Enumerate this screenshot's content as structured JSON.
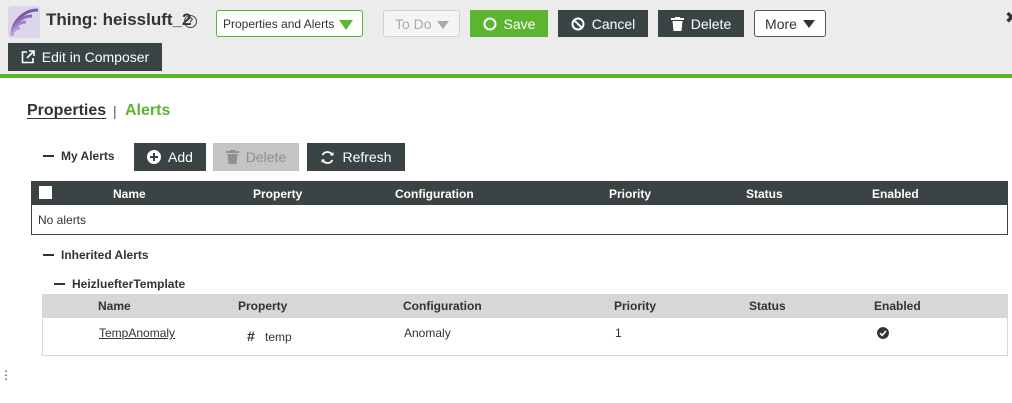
{
  "header": {
    "title": "Thing: heissluft_2",
    "help_glyph": "?",
    "view_select": "Properties and Alerts",
    "todo_select": "To Do",
    "save_label": "Save",
    "cancel_label": "Cancel",
    "delete_label": "Delete",
    "more_label": "More",
    "composer_label": "Edit in Composer",
    "close_glyph": "✖"
  },
  "tabs": {
    "properties": "Properties",
    "separator": "|",
    "alerts": "Alerts"
  },
  "my_alerts": {
    "section_label": "My Alerts",
    "add_label": "Add",
    "delete_label": "Delete",
    "refresh_label": "Refresh",
    "columns": [
      "Name",
      "Property",
      "Configuration",
      "Priority",
      "Status",
      "Enabled"
    ],
    "empty_text": "No alerts"
  },
  "inherited": {
    "section_label": "Inherited Alerts",
    "template_label": "HeizluefterTemplate",
    "columns": [
      "Name",
      "Property",
      "Configuration",
      "Priority",
      "Status",
      "Enabled"
    ],
    "rows": [
      {
        "name": "TempAnomaly",
        "property_icon": "#",
        "property": "temp",
        "configuration": "Anomaly",
        "priority": "1",
        "status": "",
        "enabled": true
      }
    ]
  },
  "colors": {
    "accent": "#5cb531",
    "dark": "#3b4444",
    "disabled": "#c4c4c4"
  }
}
